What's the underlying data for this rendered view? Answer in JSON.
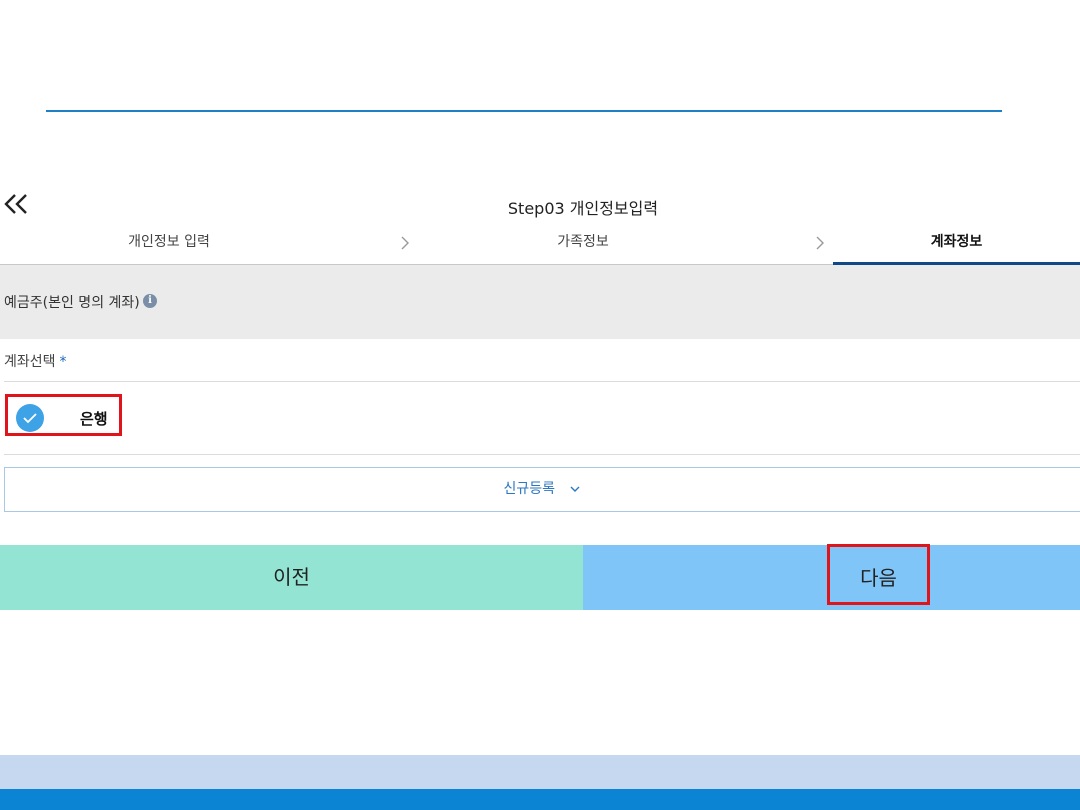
{
  "header": {
    "back_icon": "double-chevron-left-icon",
    "title": "Step03 개인정보입력"
  },
  "steps": [
    {
      "label": "개인정보 입력",
      "active": false
    },
    {
      "label": "가족정보",
      "active": false
    },
    {
      "label": "계좌정보",
      "active": true
    }
  ],
  "section": {
    "title": "예금주(본인 명의 계좌)",
    "info_icon": "i"
  },
  "account": {
    "label": "계좌선택",
    "required_mark": "*",
    "option_label": "은행",
    "option_selected": true,
    "new_registration": "신규등록"
  },
  "actions": {
    "prev_label": "이전",
    "next_label": "다음"
  },
  "colors": {
    "accent": "#0d4a87",
    "check": "#3ea2e6",
    "prev_button": "#93e4d3",
    "next_button": "#80c5f7",
    "highlight": "#e0151b"
  }
}
